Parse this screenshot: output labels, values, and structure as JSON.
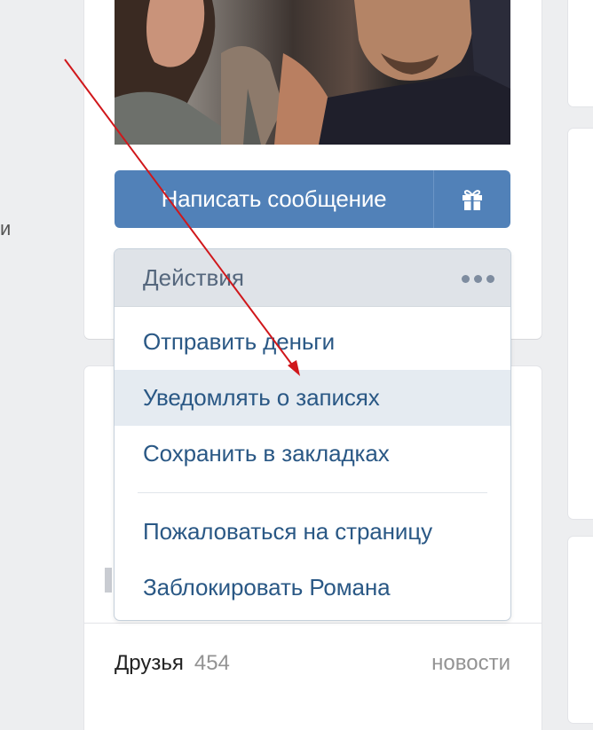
{
  "sidebar_left": {
    "fragment_text": "и"
  },
  "profile": {
    "message_button_label": "Написать сообщение",
    "gift_icon": "gift-icon"
  },
  "actions_menu": {
    "header_label": "Действия",
    "more_icon": "more-dots-icon",
    "items": [
      {
        "label": "Отправить деньги"
      },
      {
        "label": "Уведомлять о записях",
        "highlighted": true
      },
      {
        "label": "Сохранить в закладках"
      },
      {
        "label": "Пожаловаться на страницу"
      },
      {
        "label": "Заблокировать Романа"
      }
    ]
  },
  "friends": {
    "title": "Друзья",
    "count": "454",
    "link_label": "новости"
  },
  "annotation": {
    "arrow_color": "#d0171b"
  },
  "colors": {
    "accent": "#5181b8",
    "link": "#2a5885",
    "menu_hover": "#e5ebf1",
    "header_bg": "#dfe3e8"
  }
}
